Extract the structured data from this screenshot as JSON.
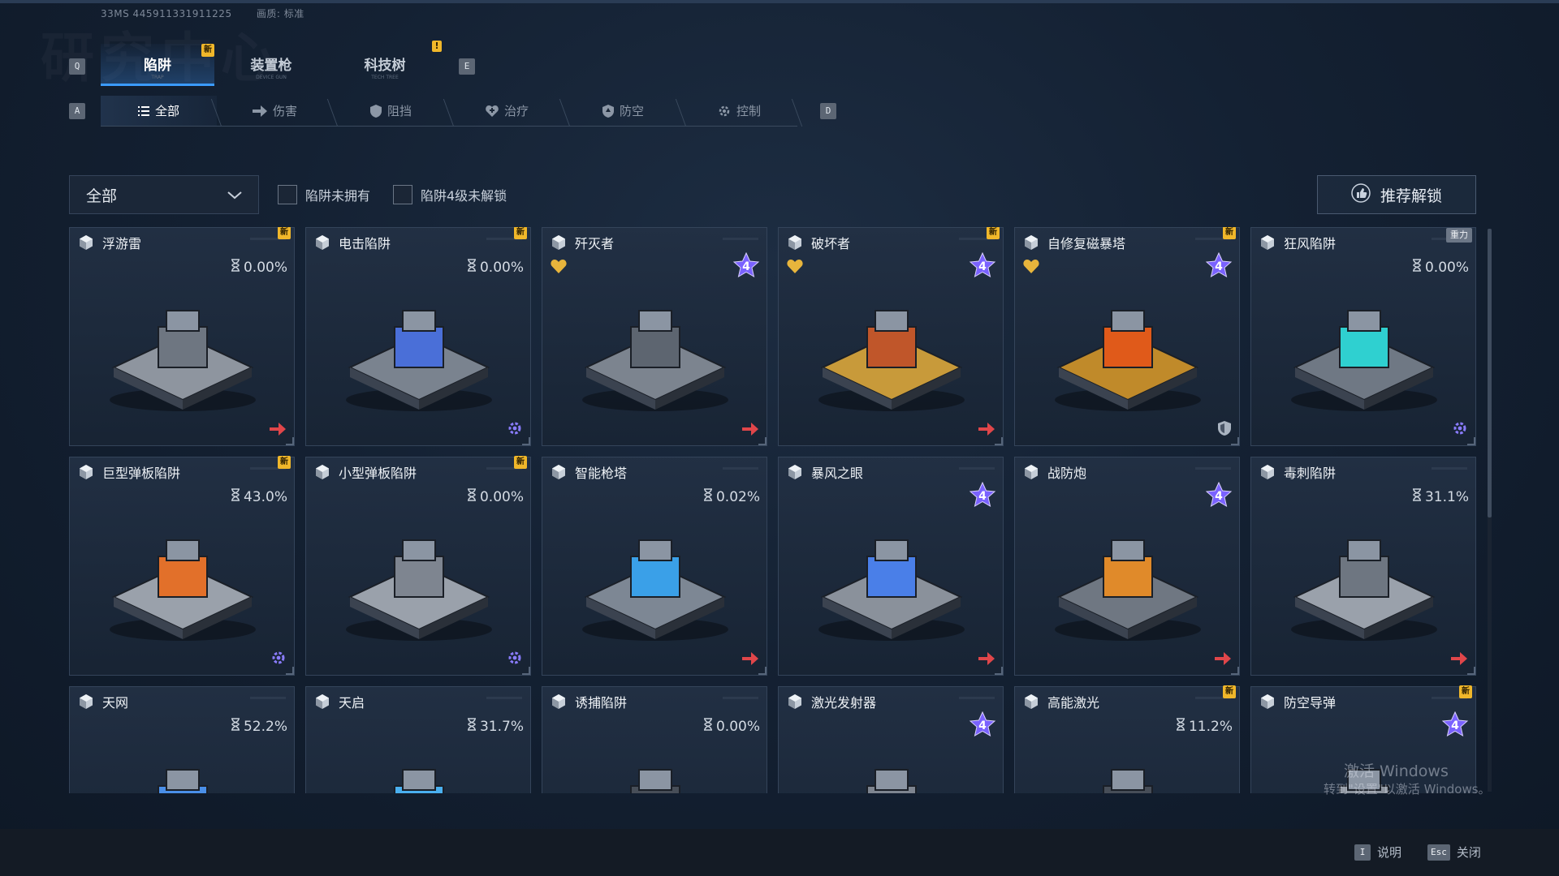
{
  "session": {
    "id": "33MS  445911331911225",
    "quality": "画质: 标准"
  },
  "background_title": "研究中心",
  "keys": {
    "prev_main": "Q",
    "next_main": "E",
    "prev_cat": "A",
    "next_cat": "D"
  },
  "main_tabs": [
    {
      "label": "陷阱",
      "sub": "TRAP",
      "badge": "新"
    },
    {
      "label": "装置枪",
      "sub": "DEVICE GUN",
      "badge": ""
    },
    {
      "label": "科技树",
      "sub": "TECH TREE",
      "badge": "!"
    }
  ],
  "category_tabs": [
    {
      "label": "全部",
      "icon": "list-icon"
    },
    {
      "label": "伤害",
      "icon": "arrow-right-icon"
    },
    {
      "label": "阻挡",
      "icon": "shield-icon"
    },
    {
      "label": "治疗",
      "icon": "heart-plus-icon"
    },
    {
      "label": "防空",
      "icon": "anti-air-shield-icon"
    },
    {
      "label": "控制",
      "icon": "gear-icon"
    }
  ],
  "filter": {
    "selected": "全部",
    "check_not_owned": "陷阱未拥有",
    "check_lv4_locked": "陷阱4级未解锁",
    "recommend_button": "推荐解锁"
  },
  "cards": [
    {
      "name": "浮游雷",
      "progress": "0.00%",
      "badge": "新",
      "tag": "",
      "star": "",
      "heart": false,
      "action": "arrow-right-icon",
      "art": "floating-mine"
    },
    {
      "name": "电击陷阱",
      "progress": "0.00%",
      "badge": "新",
      "tag": "",
      "star": "",
      "heart": false,
      "action": "gear-icon",
      "art": "shock-trap"
    },
    {
      "name": "歼灭者",
      "progress": "",
      "badge": "",
      "tag": "",
      "star": "4",
      "heart": true,
      "action": "arrow-right-icon",
      "art": "annihilator"
    },
    {
      "name": "破坏者",
      "progress": "",
      "badge": "新",
      "tag": "",
      "star": "4",
      "heart": true,
      "action": "arrow-right-icon",
      "art": "destroyer"
    },
    {
      "name": "自修复磁暴塔",
      "progress": "",
      "badge": "新",
      "tag": "",
      "star": "4",
      "heart": true,
      "action": "shield-icon",
      "art": "tesla-tower"
    },
    {
      "name": "狂风陷阱",
      "progress": "0.00%",
      "badge": "",
      "tag": "重力",
      "star": "",
      "heart": false,
      "action": "gear-icon",
      "art": "gale-trap"
    },
    {
      "name": "巨型弹板陷阱",
      "progress": "43.0%",
      "badge": "新",
      "tag": "",
      "star": "",
      "heart": false,
      "action": "gear-icon",
      "art": "giant-launchpad"
    },
    {
      "name": "小型弹板陷阱",
      "progress": "0.00%",
      "badge": "新",
      "tag": "",
      "star": "",
      "heart": false,
      "action": "gear-icon",
      "art": "small-launchpad"
    },
    {
      "name": "智能枪塔",
      "progress": "0.02%",
      "badge": "",
      "tag": "",
      "star": "",
      "heart": false,
      "action": "arrow-right-icon",
      "art": "smart-turret"
    },
    {
      "name": "暴风之眼",
      "progress": "",
      "badge": "",
      "tag": "",
      "star": "4",
      "heart": false,
      "action": "arrow-right-icon",
      "art": "storm-eye"
    },
    {
      "name": "战防炮",
      "progress": "",
      "badge": "",
      "tag": "",
      "star": "4",
      "heart": false,
      "action": "arrow-right-icon",
      "art": "battle-cannon"
    },
    {
      "name": "毒刺陷阱",
      "progress": "31.1%",
      "badge": "",
      "tag": "",
      "star": "",
      "heart": false,
      "action": "arrow-right-icon",
      "art": "sting-trap"
    },
    {
      "name": "天网",
      "progress": "52.2%",
      "badge": "",
      "tag": "",
      "star": "",
      "heart": false,
      "action": "",
      "art": "skynet"
    },
    {
      "name": "天启",
      "progress": "31.7%",
      "badge": "",
      "tag": "",
      "star": "",
      "heart": false,
      "action": "",
      "art": "apocalypse"
    },
    {
      "name": "诱捕陷阱",
      "progress": "0.00%",
      "badge": "",
      "tag": "",
      "star": "",
      "heart": false,
      "action": "",
      "art": "lure-trap"
    },
    {
      "name": "激光发射器",
      "progress": "",
      "badge": "",
      "tag": "",
      "star": "4",
      "heart": false,
      "action": "",
      "art": "laser-emitter"
    },
    {
      "name": "高能激光",
      "progress": "11.2%",
      "badge": "新",
      "tag": "",
      "star": "",
      "heart": false,
      "action": "",
      "art": "high-energy-laser"
    },
    {
      "name": "防空导弹",
      "progress": "",
      "badge": "新",
      "tag": "",
      "star": "4",
      "heart": false,
      "action": "",
      "art": "aa-missile"
    }
  ],
  "watermark": {
    "line1": "激活 Windows",
    "line2": "转到\"设置\"以激活 Windows。"
  },
  "footer": {
    "help": {
      "key": "I",
      "label": "说明"
    },
    "close": {
      "key": "Esc",
      "label": "关闭"
    }
  },
  "colors": {
    "accent": "#3b9bff",
    "badge": "#f0b72a",
    "action_red": "#e0464a",
    "action_purple": "#8a7cff",
    "heart": "#e8b53c",
    "star": "#7a62ff"
  }
}
